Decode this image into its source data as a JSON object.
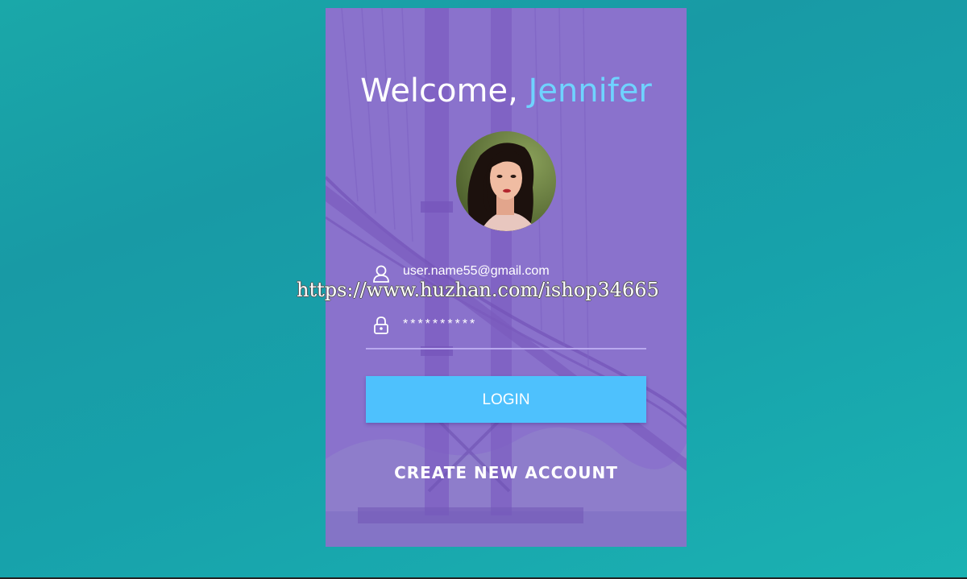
{
  "login_card": {
    "welcome_prefix": "Welcome,",
    "user_name": "Jennifer",
    "email_value": "user.name55@gmail.com",
    "password_value": "**********",
    "login_label": "LOGIN",
    "create_account_label": "CREATE NEW ACCOUNT"
  },
  "watermark": "https://www.huzhan.com/ishop34665",
  "icons": {
    "username": "user-icon",
    "password": "lock-icon"
  },
  "colors": {
    "background": "#1aa8a9",
    "card": "#8a70c9",
    "accent_name": "#6fd3ff",
    "login_button": "#4ec1fd"
  }
}
